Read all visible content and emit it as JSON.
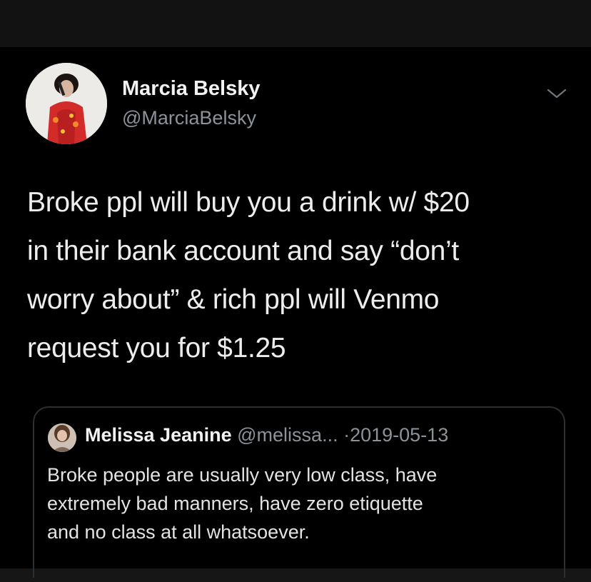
{
  "tweet": {
    "author": {
      "name": "Marcia Belsky",
      "handle": "@MarciaBelsky",
      "avatar_icon": "user-avatar-photo"
    },
    "menu_icon": "chevron-down-icon",
    "text_lines": [
      "Broke ppl will buy you a drink w/ $20",
      "in their bank account and say “don’t",
      "worry about” & rich ppl will Venmo",
      "request you for $1.25"
    ]
  },
  "quoted_tweet": {
    "author": {
      "name": "Melissa Jeanine",
      "handle": "@melissa...",
      "avatar_icon": "user-avatar-photo"
    },
    "separator": "·",
    "date": "2019-05-13",
    "text_lines": [
      "Broke people are usually very low class, have",
      "extremely bad manners, have zero etiquette",
      "and no class at all whatsoever."
    ]
  },
  "colors": {
    "background": "#000000",
    "primary_text": "#e7e9ea",
    "secondary_text": "#8b9298",
    "border": "#2a2f33"
  }
}
